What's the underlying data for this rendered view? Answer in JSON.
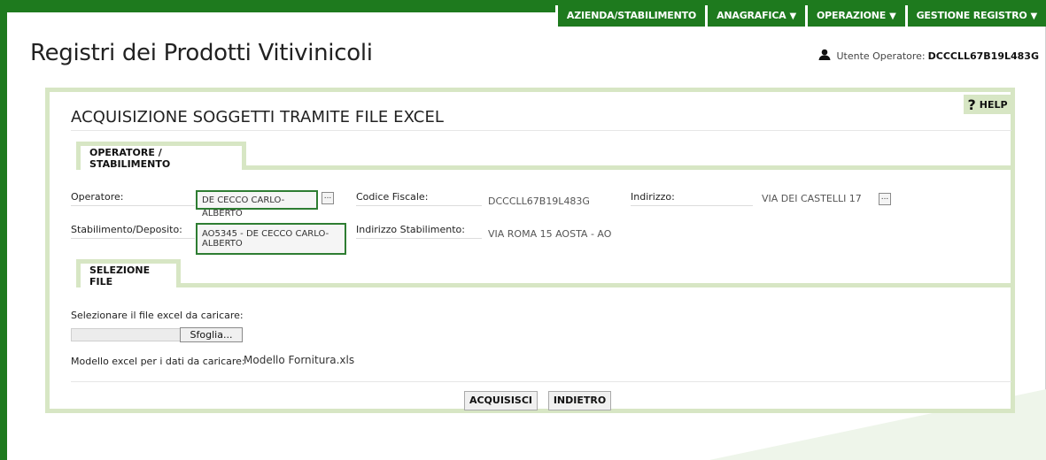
{
  "nav": {
    "items": [
      {
        "label": "AZIENDA/STABILIMENTO",
        "has_arrow": false
      },
      {
        "label": "ANAGRAFICA",
        "has_arrow": true
      },
      {
        "label": "OPERAZIONE",
        "has_arrow": true
      },
      {
        "label": "GESTIONE REGISTRO",
        "has_arrow": true
      }
    ],
    "arrow": "▼"
  },
  "header": {
    "title": "Registri dei Prodotti Vitivinicoli",
    "user_label": "Utente Operatore:",
    "user_code": "DCCCLL67B19L483G"
  },
  "panel": {
    "title": "ACQUISIZIONE SOGGETTI TRAMITE FILE EXCEL",
    "help_label": "HELP",
    "help_symbol": "?"
  },
  "operatore_tab": {
    "label": "OPERATORE / STABILIMENTO",
    "operatore_label": "Operatore:",
    "operatore_value": "DE CECCO CARLO-ALBERTO",
    "codice_fiscale_label": "Codice Fiscale:",
    "codice_fiscale_value": "DCCCLL67B19L483G",
    "indirizzo_label": "Indirizzo:",
    "indirizzo_value": "VIA DEI CASTELLI 17",
    "stabilimento_label": "Stabilimento/Deposito:",
    "stabilimento_value": "AO5345 - DE CECCO CARLO-ALBERTO",
    "indirizzo_stab_label": "Indirizzo Stabilimento:",
    "indirizzo_stab_value": "VIA ROMA 15 AOSTA -  AO",
    "lookup_button": "..."
  },
  "file_tab": {
    "label": "SELEZIONE FILE",
    "select_label": "Selezionare il file excel da caricare:",
    "browse_label": "Sfoglia...",
    "model_label": "Modello excel per i dati da caricare:",
    "model_link": "Modello Fornitura.xls"
  },
  "actions": {
    "acquire": "ACQUISISCI",
    "back": "INDIETRO"
  },
  "colors": {
    "brand_green": "#1e7a1e",
    "panel_border": "#d7e6c4",
    "field_border": "#2e7d32"
  }
}
